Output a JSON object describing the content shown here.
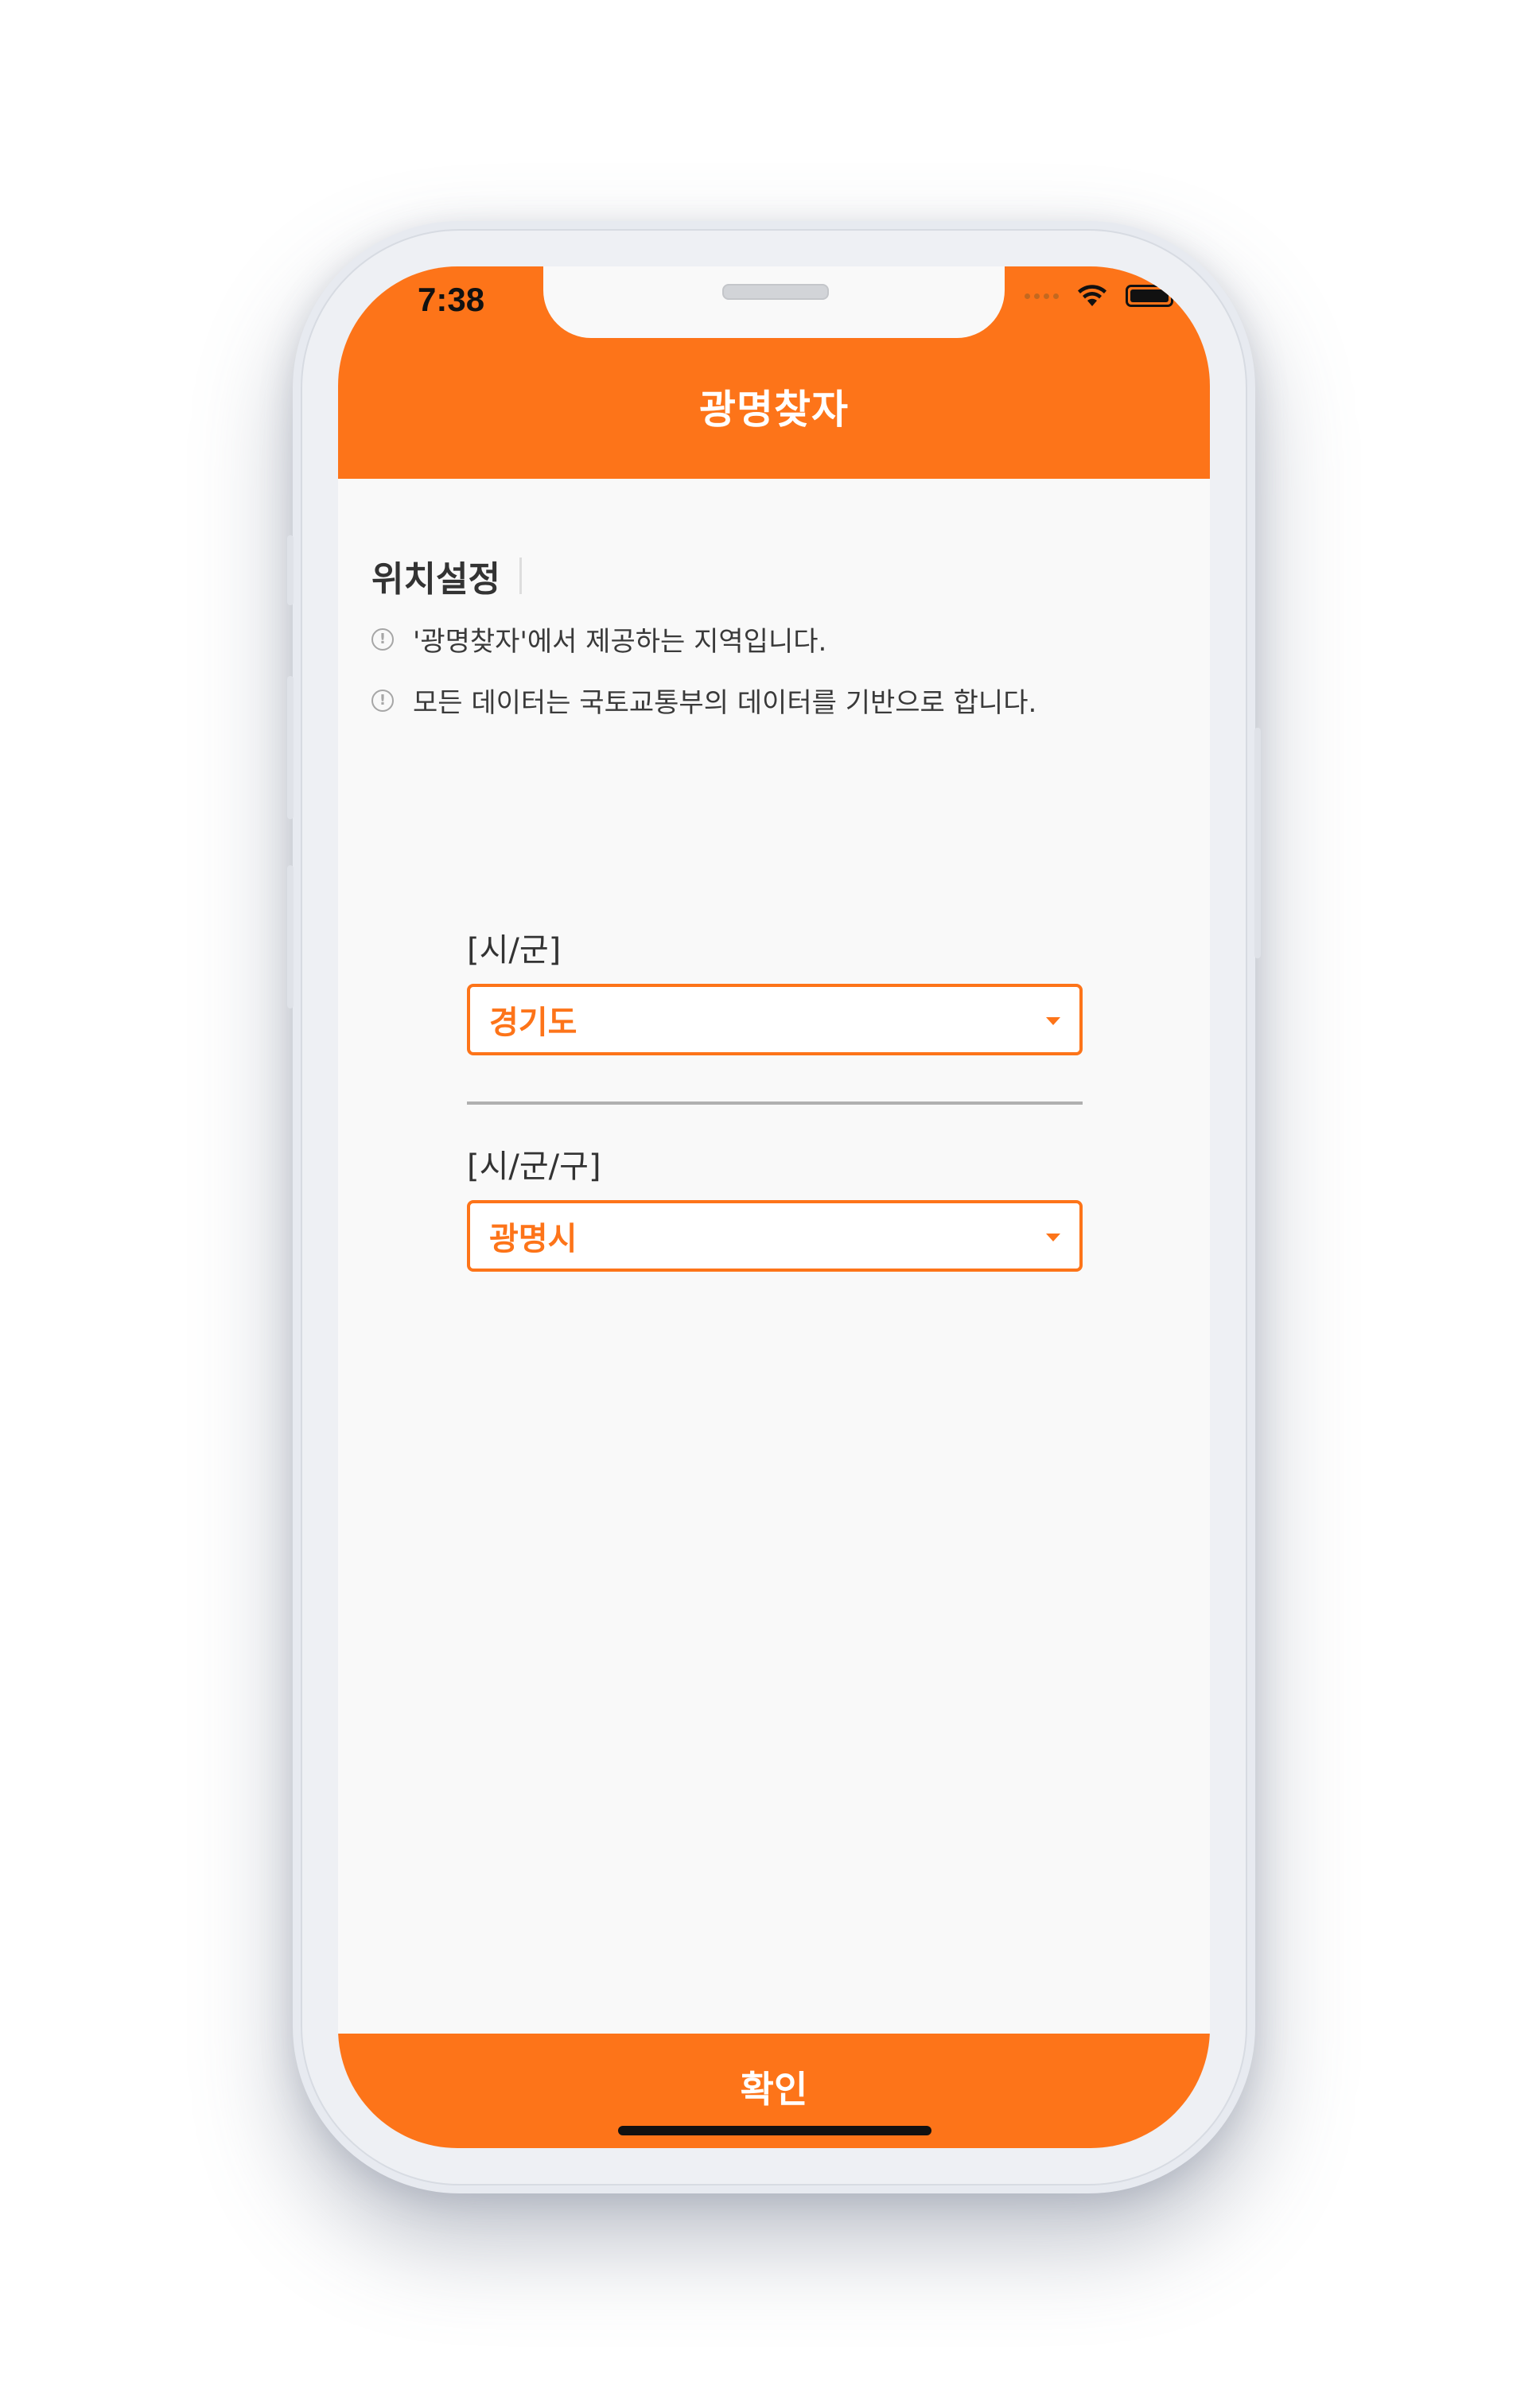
{
  "status_bar": {
    "time": "7:38",
    "icons": [
      "signal-dots-icon",
      "wifi-icon",
      "battery-icon"
    ]
  },
  "header": {
    "title": "광명찾자",
    "background": "#fd7419"
  },
  "location": {
    "section_title": "위치설정",
    "info": [
      "'광명찾자'에서 제공하는 지역입니다.",
      "모든 데이터는 국토교통부의 데이터를 기반으로 합니다."
    ]
  },
  "province_field": {
    "label": "[시/군]",
    "value": "경기도"
  },
  "city_field": {
    "label": "[시/군/구]",
    "value": "광명시"
  },
  "footer": {
    "confirm_label": "확인"
  },
  "colors": {
    "accent": "#fd7419",
    "background": "#f9f9f9"
  }
}
